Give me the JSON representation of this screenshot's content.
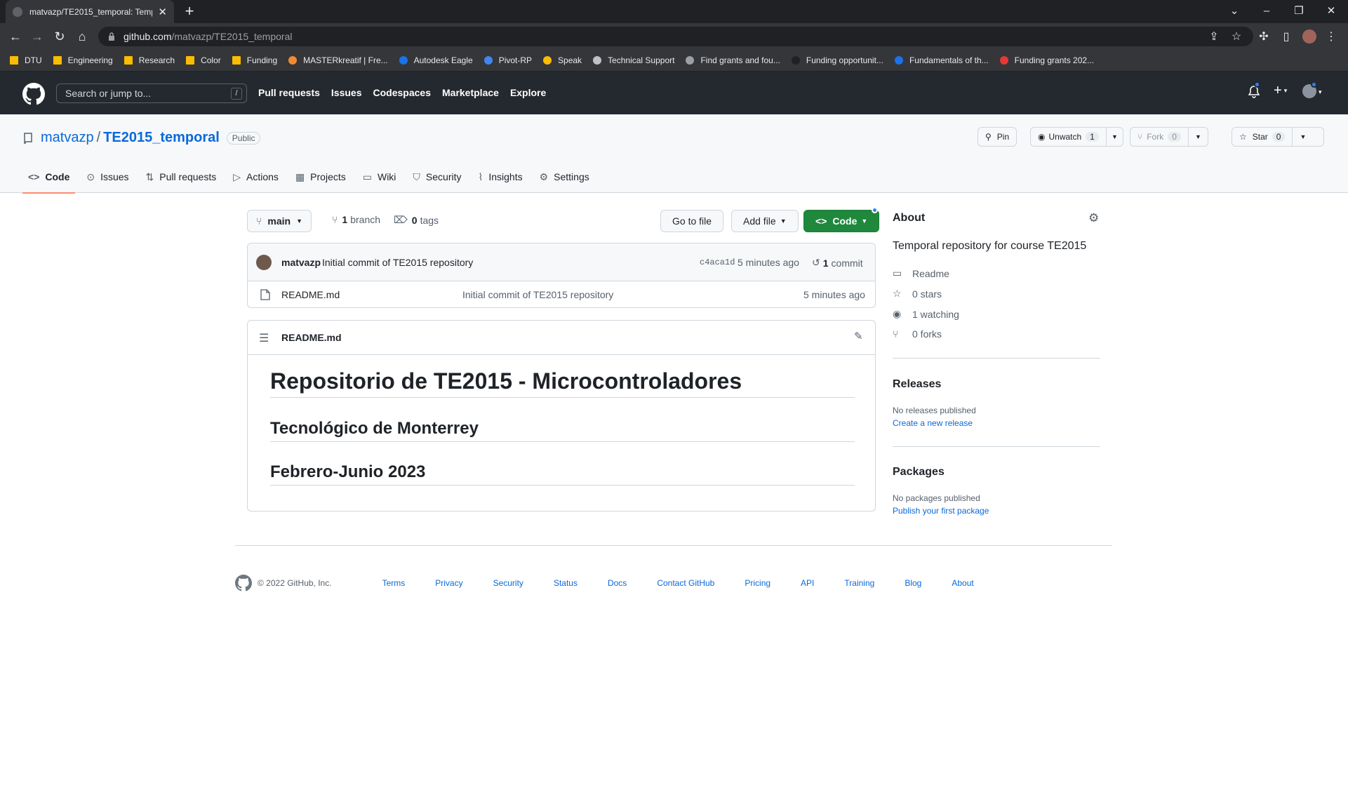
{
  "browser": {
    "tab_title": "matvazp/TE2015_temporal: Temp",
    "url_domain": "github.com",
    "url_path": "/matvazp/TE2015_temporal",
    "bookmarks": [
      {
        "label": "DTU",
        "icon": "folder-icon"
      },
      {
        "label": "Engineering",
        "icon": "folder-icon"
      },
      {
        "label": "Research",
        "icon": "folder-icon"
      },
      {
        "label": "Color",
        "icon": "folder-icon"
      },
      {
        "label": "Funding",
        "icon": "folder-icon"
      },
      {
        "label": "MASTERkreatif | Fre...",
        "icon": "site-icon"
      },
      {
        "label": "Autodesk Eagle",
        "icon": "site-icon"
      },
      {
        "label": "Pivot-RP",
        "icon": "site-icon"
      },
      {
        "label": "Speak",
        "icon": "site-icon"
      },
      {
        "label": "Technical Support",
        "icon": "globe-icon"
      },
      {
        "label": "Find grants and fou...",
        "icon": "site-icon"
      },
      {
        "label": "Funding opportunit...",
        "icon": "site-icon"
      },
      {
        "label": "Fundamentals of th...",
        "icon": "site-icon"
      },
      {
        "label": "Funding grants 202...",
        "icon": "site-icon"
      }
    ]
  },
  "header": {
    "search_placeholder": "Search or jump to...",
    "search_shortcut": "/",
    "nav": [
      "Pull requests",
      "Issues",
      "Codespaces",
      "Marketplace",
      "Explore"
    ]
  },
  "repo": {
    "owner": "matvazp",
    "separator": "/",
    "name": "TE2015_temporal",
    "visibility": "Public",
    "pin_label": "Pin",
    "unwatch_label": "Unwatch",
    "unwatch_count": "1",
    "fork_label": "Fork",
    "fork_count": "0",
    "star_label": "Star",
    "star_count": "0",
    "tabs": [
      "Code",
      "Issues",
      "Pull requests",
      "Actions",
      "Projects",
      "Wiki",
      "Security",
      "Insights",
      "Settings"
    ]
  },
  "toolbar": {
    "branch": "main",
    "branch_count": "1",
    "branch_label": "branch",
    "tag_count": "0",
    "tag_label": "tags",
    "goto_file": "Go to file",
    "add_file": "Add file",
    "code": "Code"
  },
  "commit": {
    "author": "matvazp",
    "message": "Initial commit of TE2015 repository",
    "sha": "c4aca1d",
    "time": "5 minutes ago",
    "count": "1",
    "count_label": "commit"
  },
  "files": [
    {
      "name": "README.md",
      "message": "Initial commit of TE2015 repository",
      "time": "5 minutes ago"
    }
  ],
  "readme": {
    "filename": "README.md",
    "h1": "Repositorio de TE2015 - Microcontroladores",
    "h2a": "Tecnológico de Monterrey",
    "h2b": "Febrero-Junio 2023"
  },
  "about": {
    "title": "About",
    "description": "Temporal repository for course TE2015",
    "readme": "Readme",
    "stars": "0 stars",
    "watching": "1 watching",
    "forks": "0 forks",
    "releases_title": "Releases",
    "releases_none": "No releases published",
    "releases_link": "Create a new release",
    "packages_title": "Packages",
    "packages_none": "No packages published",
    "packages_link": "Publish your first package"
  },
  "footer": {
    "copyright": "© 2022 GitHub, Inc.",
    "links": [
      "Terms",
      "Privacy",
      "Security",
      "Status",
      "Docs",
      "Contact GitHub",
      "Pricing",
      "API",
      "Training",
      "Blog",
      "About"
    ]
  },
  "colors": {
    "accent_link": "#0969da",
    "code_button": "#1f883d",
    "tab_underline": "#fd8c73",
    "header_bg": "#24292f"
  }
}
